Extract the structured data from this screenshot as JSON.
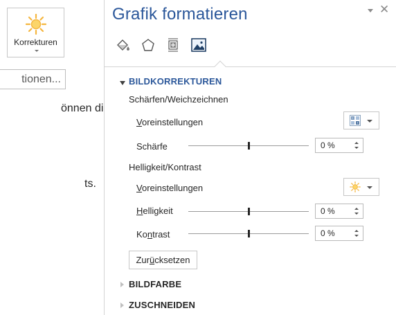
{
  "background": {
    "korrekturen_label": "Korrekturen",
    "optionen_label": "tionen...",
    "snippet_1": "önnen die",
    "snippet_2": "ts."
  },
  "panel": {
    "title": "Grafik formatieren",
    "tabs": [
      "fill-line-icon",
      "effects-icon",
      "layout-properties-icon",
      "picture-icon"
    ],
    "active_tab": "picture-icon",
    "sections": {
      "bildkorrekturen": {
        "header": "BILDKORREKTUREN",
        "expanded": true,
        "schaerfen_group": "Schärfen/Weichzeichnen",
        "voreinstellungen_1_pre": "",
        "voreinstellungen_1_u": "V",
        "voreinstellungen_1_post": "oreinstellungen",
        "schaerfe_label": "Schärfe",
        "schaerfe_value": "0 %",
        "helligkeit_group": "Helligkeit/Kontrast",
        "voreinstellungen_2_pre": "",
        "voreinstellungen_2_u": "V",
        "voreinstellungen_2_post": "oreinstellungen",
        "helligkeit_pre": "",
        "helligkeit_u": "H",
        "helligkeit_post": "elligkeit",
        "helligkeit_value": "0 %",
        "kontrast_pre": "Ko",
        "kontrast_u": "n",
        "kontrast_post": "trast",
        "kontrast_value": "0 %",
        "reset_pre": "Zur",
        "reset_u": "ü",
        "reset_post": "cksetzen"
      },
      "bildfarbe": {
        "header": "BILDFARBE",
        "expanded": false
      },
      "zuschneiden": {
        "header": "ZUSCHNEIDEN",
        "expanded": false
      }
    },
    "sliders": {
      "schaerfe": 0.5,
      "helligkeit": 0.5,
      "kontrast": 0.5
    }
  },
  "colors": {
    "title_blue": "#2b579a",
    "sun_orange": "#f5b63f"
  }
}
